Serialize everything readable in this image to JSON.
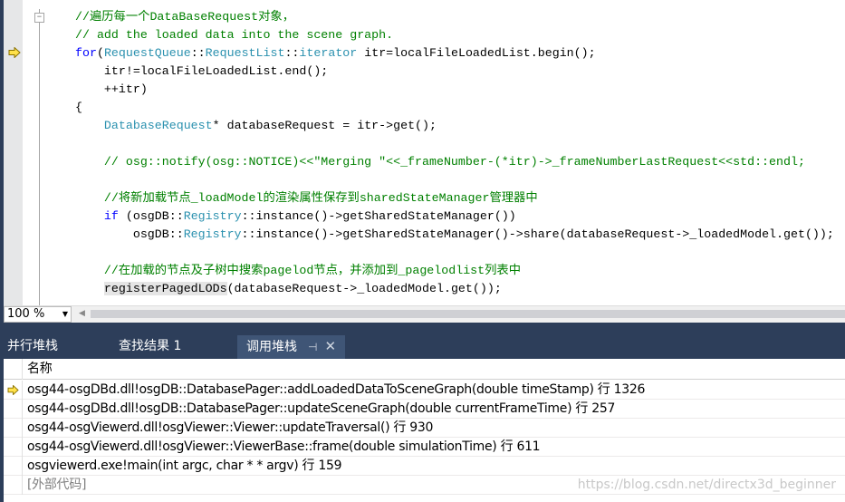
{
  "editor": {
    "lines": [
      [
        [
          "//遍历每一个DataBaseRequest对象，",
          "cm"
        ]
      ],
      [
        [
          "// add the loaded data into the scene graph.",
          "cm"
        ]
      ],
      [
        [
          "for",
          "kw"
        ],
        [
          "(",
          ""
        ],
        [
          "RequestQueue",
          "ty"
        ],
        [
          "::",
          ""
        ],
        [
          "RequestList",
          "ty"
        ],
        [
          "::",
          ""
        ],
        [
          "iterator",
          "ty"
        ],
        [
          " itr=localFileLoadedList.begin();",
          ""
        ]
      ],
      [
        [
          "    itr!=localFileLoadedList.end();",
          ""
        ]
      ],
      [
        [
          "    ++itr)",
          ""
        ]
      ],
      [
        [
          "{",
          ""
        ]
      ],
      [
        [
          "    ",
          ""
        ],
        [
          "DatabaseRequest",
          "ty"
        ],
        [
          "* databaseRequest = itr->get();",
          ""
        ]
      ],
      [
        [
          "",
          ""
        ]
      ],
      [
        [
          "    ",
          ""
        ],
        [
          "// osg::notify(osg::NOTICE)<<\"Merging \"<<_frameNumber-(*itr)->_frameNumberLastRequest<<std::endl;",
          "cm"
        ]
      ],
      [
        [
          "",
          ""
        ]
      ],
      [
        [
          "    ",
          ""
        ],
        [
          "//将新加载节点_loadModel的渲染属性保存到sharedStateManager管理器中",
          "cm"
        ]
      ],
      [
        [
          "    ",
          ""
        ],
        [
          "if",
          "kw"
        ],
        [
          " (osgDB::",
          ""
        ],
        [
          "Registry",
          "ty"
        ],
        [
          "::instance()->getSharedStateManager())",
          ""
        ]
      ],
      [
        [
          "        osgDB::",
          ""
        ],
        [
          "Registry",
          "ty"
        ],
        [
          "::instance()->getSharedStateManager()->share(databaseRequest->_loadedModel.get());",
          ""
        ]
      ],
      [
        [
          "",
          ""
        ]
      ],
      [
        [
          "    ",
          ""
        ],
        [
          "//在加载的节点及子树中搜索pagelod节点，并添加到_pagelodlist列表中",
          "cm"
        ]
      ],
      [
        [
          "    ",
          ""
        ],
        [
          "registerPagedLODs",
          "hl"
        ],
        [
          "(databaseRequest->_loadedModel.get());",
          ""
        ]
      ]
    ],
    "current_line_icon": "yellow-arrow-icon",
    "zoom_level": "100 %"
  },
  "panel": {
    "tabs": [
      {
        "label": "并行堆栈"
      },
      {
        "label": "查找结果 1"
      },
      {
        "label": "调用堆栈",
        "active": true
      }
    ],
    "pin_icon": "pin-icon",
    "close_icon": "close-icon"
  },
  "callstack": {
    "header": "名称",
    "rows": [
      {
        "name": "osg44-osgDBd.dll!osgDB::DatabasePager::addLoadedDataToSceneGraph(double timeStamp) 行 1326",
        "current": true
      },
      {
        "name": "osg44-osgDBd.dll!osgDB::DatabasePager::updateSceneGraph(double currentFrameTime) 行 257"
      },
      {
        "name": "osg44-osgViewerd.dll!osgViewer::Viewer::updateTraversal() 行 930"
      },
      {
        "name": "osg44-osgViewerd.dll!osgViewer::ViewerBase::frame(double simulationTime) 行 611"
      },
      {
        "name": "osgviewerd.exe!main(int argc, char * * argv) 行 159"
      },
      {
        "name": "[外部代码]",
        "external": true
      }
    ]
  },
  "watermark": "https://blog.csdn.net/directx3d_beginner",
  "colors": {
    "comment": "#008000",
    "keyword": "#0000ff",
    "type": "#2b91af",
    "panel": "#2d3e5a",
    "active_tab": "#3f5576"
  }
}
